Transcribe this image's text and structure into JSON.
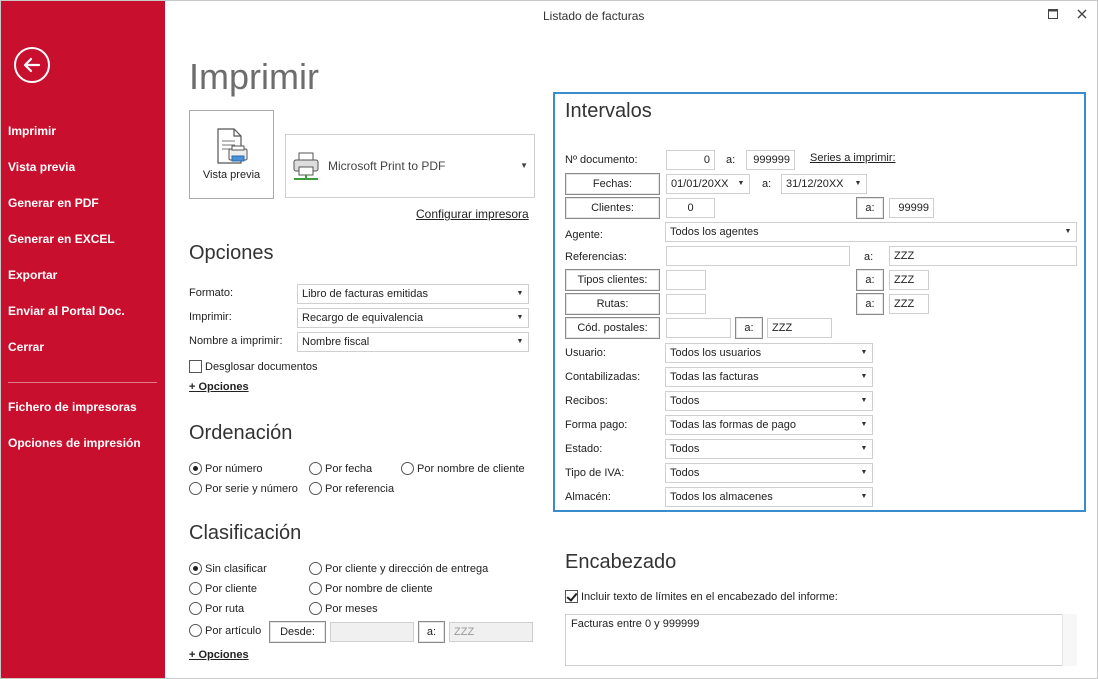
{
  "window": {
    "title": "Listado de facturas"
  },
  "sidebar": {
    "items": [
      "Imprimir",
      "Vista previa",
      "Generar en PDF",
      "Generar en EXCEL",
      "Exportar",
      "Enviar al Portal Doc.",
      "Cerrar"
    ],
    "extra": [
      "Fichero de impresoras",
      "Opciones de impresión"
    ]
  },
  "main": {
    "title": "Imprimir",
    "preview_label": "Vista previa",
    "printer": "Microsoft Print to PDF",
    "config_printer": "Configurar impresora"
  },
  "opciones": {
    "title": "Opciones",
    "formato_label": "Formato:",
    "formato_value": "Libro de facturas emitidas",
    "imprimir_label": "Imprimir:",
    "imprimir_value": "Recargo de equivalencia",
    "nombre_label": "Nombre a imprimir:",
    "nombre_value": "Nombre fiscal",
    "desglosar": "Desglosar documentos",
    "mas": "+ Opciones"
  },
  "ordenacion": {
    "title": "Ordenación",
    "options": [
      "Por número",
      "Por fecha",
      "Por nombre de cliente",
      "Por serie y número",
      "Por referencia"
    ],
    "selected": "Por número"
  },
  "clasificacion": {
    "title": "Clasificación",
    "options": [
      "Sin clasificar",
      "Por cliente y dirección de entrega",
      "Por cliente",
      "Por nombre de cliente",
      "Por ruta",
      "Por meses",
      "Por artículo"
    ],
    "selected": "Sin clasificar",
    "desde_label": "Desde:",
    "a_label": "a:",
    "a_value": "ZZZ",
    "mas": "+ Opciones"
  },
  "intervalos": {
    "title": "Intervalos",
    "documento_label": "Nº documento:",
    "documento_from": "0",
    "documento_to": "999999",
    "series": "Series a imprimir:",
    "fechas_btn": "Fechas:",
    "fecha_from": "01/01/20XX",
    "fecha_to": "31/12/20XX",
    "clientes_btn": "Clientes:",
    "clientes_from": "0",
    "clientes_to": "99999",
    "agente_label": "Agente:",
    "agente_value": "Todos los agentes",
    "referencias_label": "Referencias:",
    "referencias_to": "ZZZ",
    "tipos_btn": "Tipos clientes:",
    "tipos_to": "ZZZ",
    "rutas_btn": "Rutas:",
    "rutas_to": "ZZZ",
    "cp_btn": "Cód. postales:",
    "cp_to": "ZZZ",
    "a": "a:",
    "usuario_label": "Usuario:",
    "usuario_value": "Todos los usuarios",
    "contab_label": "Contabilizadas:",
    "contab_value": "Todas las facturas",
    "recibos_label": "Recibos:",
    "recibos_value": "Todos",
    "forma_label": "Forma pago:",
    "forma_value": "Todas las formas de pago",
    "estado_label": "Estado:",
    "estado_value": "Todos",
    "iva_label": "Tipo de IVA:",
    "iva_value": "Todos",
    "almacen_label": "Almacén:",
    "almacen_value": "Todos los almacenes"
  },
  "encabezado": {
    "title": "Encabezado",
    "incluir": "Incluir texto de límites en el encabezado del informe:",
    "text": "Facturas entre 0 y 999999"
  },
  "colors": {
    "sidebar": "#c8102e",
    "panel_border": "#3a8ccc"
  }
}
